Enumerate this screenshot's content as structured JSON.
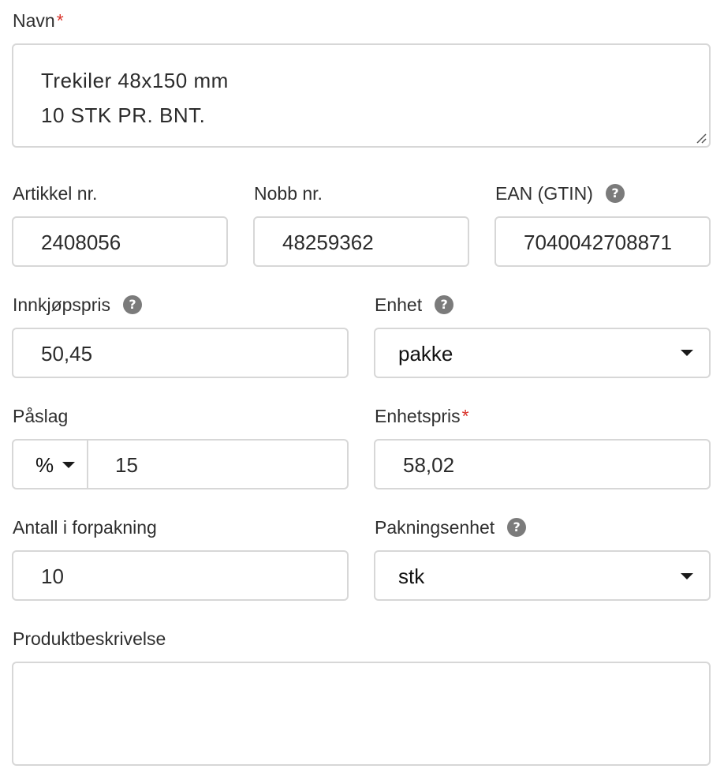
{
  "form": {
    "name": {
      "label": "Navn",
      "required_mark": "*",
      "line1": "Trekiler 48x150 mm",
      "line2": "10 STK PR. BNT."
    },
    "article_nr": {
      "label": "Artikkel nr.",
      "value": "2408056"
    },
    "nobb_nr": {
      "label": "Nobb nr.",
      "value": "48259362"
    },
    "ean": {
      "label": "EAN (GTIN)",
      "help": "?",
      "value": "7040042708871"
    },
    "purchase_price": {
      "label": "Innkjøpspris",
      "help": "?",
      "value": "50,45"
    },
    "unit": {
      "label": "Enhet",
      "help": "?",
      "selected": "pakke"
    },
    "markup": {
      "label": "Påslag",
      "type_selected": "%",
      "value": "15"
    },
    "unit_price": {
      "label": "Enhetspris",
      "required_mark": "*",
      "value": "58,02"
    },
    "package_qty": {
      "label": "Antall i forpakning",
      "value": "10"
    },
    "package_unit": {
      "label": "Pakningsenhet",
      "help": "?",
      "selected": "stk"
    },
    "description": {
      "label": "Produktbeskrivelse",
      "value": ""
    }
  },
  "colors": {
    "required": "#d9342b",
    "border": "#d7d7d7",
    "help_icon": "#7b7b7b",
    "text": "#2b2b2b"
  }
}
